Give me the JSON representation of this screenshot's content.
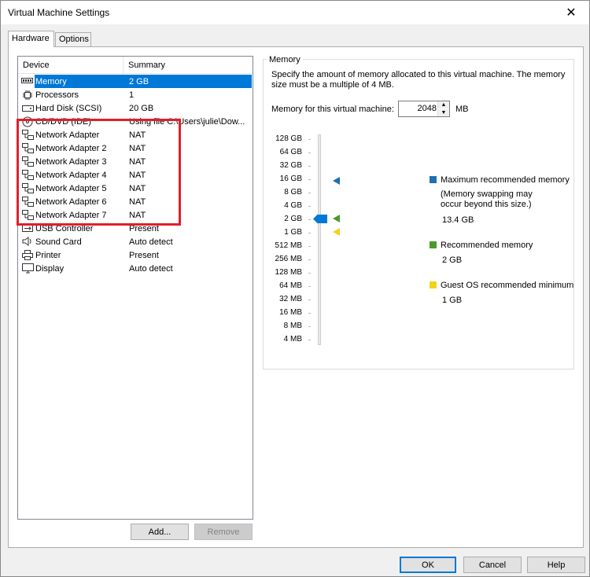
{
  "window": {
    "title": "Virtual Machine Settings",
    "close_glyph": "✕"
  },
  "tabs": [
    {
      "label": "Hardware"
    },
    {
      "label": "Options"
    }
  ],
  "device_list": {
    "col_device": "Device",
    "col_summary": "Summary",
    "rows": [
      {
        "device": "Memory",
        "summary": "2 GB",
        "icon": "memory-icon"
      },
      {
        "device": "Processors",
        "summary": "1",
        "icon": "processor-icon"
      },
      {
        "device": "Hard Disk (SCSI)",
        "summary": "20 GB",
        "icon": "hard-disk-icon"
      },
      {
        "device": "CD/DVD (IDE)",
        "summary": "Using file C:\\Users\\julie\\Dow...",
        "icon": "cd-dvd-icon"
      },
      {
        "device": "Network Adapter",
        "summary": "NAT",
        "icon": "network-adapter-icon"
      },
      {
        "device": "Network Adapter 2",
        "summary": "NAT",
        "icon": "network-adapter-icon"
      },
      {
        "device": "Network Adapter 3",
        "summary": "NAT",
        "icon": "network-adapter-icon"
      },
      {
        "device": "Network Adapter 4",
        "summary": "NAT",
        "icon": "network-adapter-icon"
      },
      {
        "device": "Network Adapter 5",
        "summary": "NAT",
        "icon": "network-adapter-icon"
      },
      {
        "device": "Network Adapter 6",
        "summary": "NAT",
        "icon": "network-adapter-icon"
      },
      {
        "device": "Network Adapter 7",
        "summary": "NAT",
        "icon": "network-adapter-icon"
      },
      {
        "device": "USB Controller",
        "summary": "Present",
        "icon": "usb-icon"
      },
      {
        "device": "Sound Card",
        "summary": "Auto detect",
        "icon": "speaker-icon"
      },
      {
        "device": "Printer",
        "summary": "Present",
        "icon": "printer-icon"
      },
      {
        "device": "Display",
        "summary": "Auto detect",
        "icon": "monitor-icon"
      }
    ],
    "selected_index": 0
  },
  "list_buttons": {
    "add": "Add...",
    "remove": "Remove"
  },
  "memory": {
    "group_title": "Memory",
    "description": "Specify the amount of memory allocated to this virtual machine. The memory size must be a multiple of 4 MB.",
    "field_label": "Memory for this virtual machine:",
    "value": "2048",
    "unit": "MB",
    "spin_up": "▲",
    "spin_down": "▼",
    "scale_labels": [
      "128 GB",
      "64 GB",
      "32 GB",
      "16 GB",
      "8 GB",
      "4 GB",
      "2 GB",
      "1 GB",
      "512 MB",
      "256 MB",
      "128 MB",
      "64 MB",
      "32 MB",
      "16 MB",
      "8 MB",
      "4 MB"
    ],
    "legend": {
      "max_label": "Maximum recommended memory",
      "max_note": "(Memory swapping may occur beyond this size.)",
      "max_value": "13.4 GB",
      "rec_label": "Recommended memory",
      "rec_value": "2 GB",
      "min_label": "Guest OS recommended minimum",
      "min_value": "1 GB"
    },
    "colors": {
      "max": "#1e6fb4",
      "rec": "#4a9a2a",
      "min": "#f2d21b",
      "thumb": "#0078d7"
    }
  },
  "footer": {
    "ok": "OK",
    "cancel": "Cancel",
    "help": "Help"
  }
}
